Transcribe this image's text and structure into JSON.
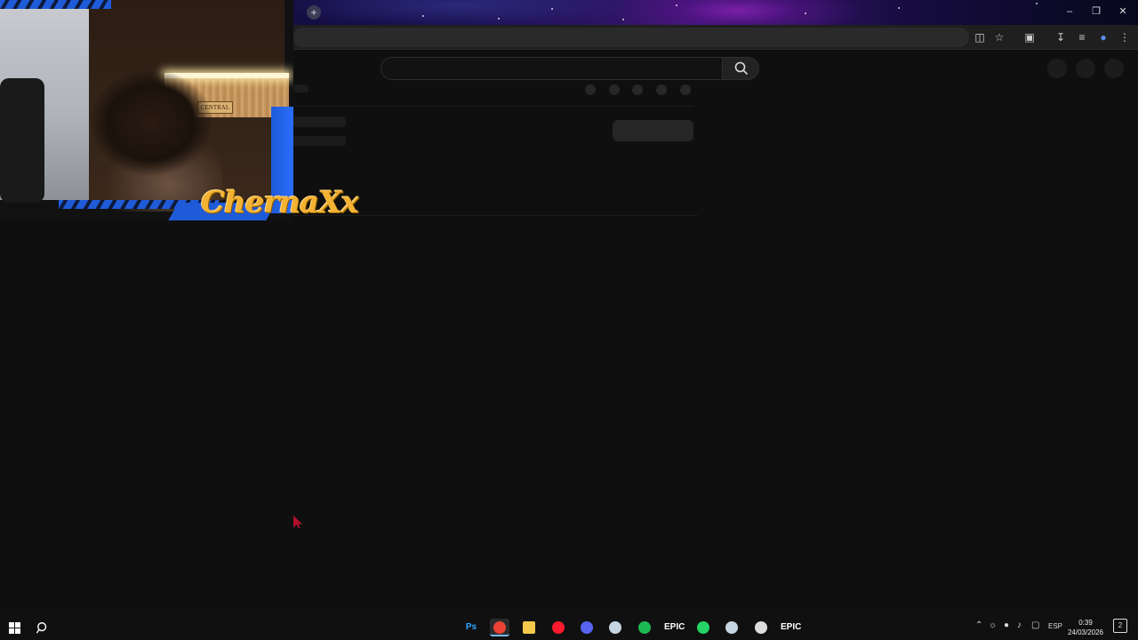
{
  "webcam": {
    "streamer_name": "ChernaXx",
    "sign_text": "CENTRAL"
  },
  "browser": {
    "new_tab_icon": "plus-icon",
    "toolbar_icons": [
      "install-app-icon",
      "star-icon",
      "extensions-icon",
      "download-icon",
      "media-controls-icon",
      "profile-icon",
      "menu-icon"
    ]
  },
  "page": {
    "search_placeholder": "",
    "search_icon": "search-icon"
  },
  "taskbar": {
    "apps": [
      {
        "name": "photoshop",
        "label": "Ps",
        "color": "#31a8ff"
      },
      {
        "name": "chrome",
        "label": "",
        "color": "#ea4335"
      },
      {
        "name": "file-explorer",
        "label": "",
        "color": "#f2c94c"
      },
      {
        "name": "opera",
        "label": "",
        "color": "#ff1b2d"
      },
      {
        "name": "discord",
        "label": "",
        "color": "#5865f2"
      },
      {
        "name": "steam",
        "label": "",
        "color": "#c7d5e0"
      },
      {
        "name": "spotify",
        "label": "",
        "color": "#1db954"
      },
      {
        "name": "epic-games",
        "label": "EPIC",
        "color": "#ffffff"
      },
      {
        "name": "whatsapp",
        "label": "",
        "color": "#25d366"
      },
      {
        "name": "steam-2",
        "label": "",
        "color": "#c7d5e0"
      },
      {
        "name": "obs",
        "label": "",
        "color": "#dddddd"
      },
      {
        "name": "epic-games-2",
        "label": "EPIC",
        "color": "#ffffff"
      }
    ],
    "language": "ESP",
    "time": "0:39",
    "date": "24/03/2026",
    "notification_count": "2"
  }
}
